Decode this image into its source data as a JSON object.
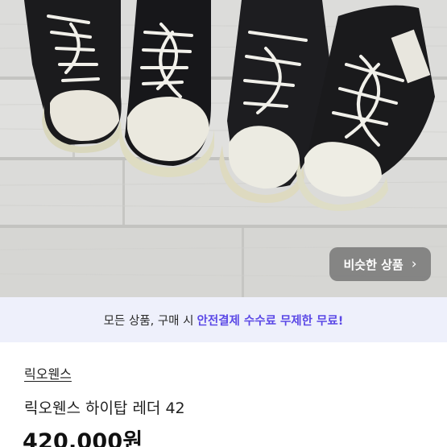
{
  "product_image": {
    "alt": ""
  },
  "similar_button": {
    "label": "비슷한 상품",
    "chevron": "›"
  },
  "promo_banner": {
    "prefix": "모든 상품, 구매 시",
    "highlight": "안전결제 수수료 무제한 무료!",
    "accent_color": "#5b48e6"
  },
  "product": {
    "brand": "릭오웬스",
    "title": "릭오웬스 하이탑 레더 42",
    "price": "420,000원"
  }
}
